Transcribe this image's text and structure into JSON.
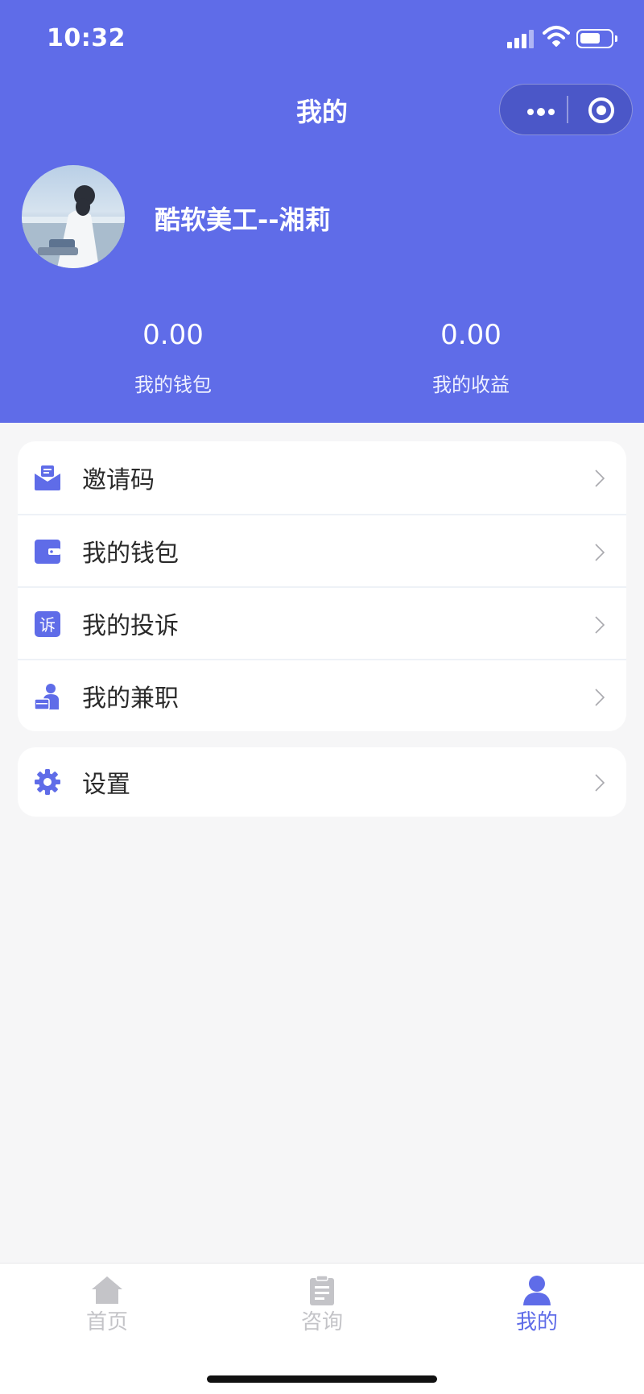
{
  "status": {
    "time": "10:32"
  },
  "nav": {
    "title": "我的"
  },
  "profile": {
    "name": "酷软美工--湘莉"
  },
  "stats": [
    {
      "value": "0.00",
      "label": "我的钱包"
    },
    {
      "value": "0.00",
      "label": "我的收益"
    }
  ],
  "menu": {
    "items": [
      {
        "label": "邀请码",
        "icon": "invite-envelope-icon"
      },
      {
        "label": "我的钱包",
        "icon": "wallet-icon"
      },
      {
        "label": "我的投诉",
        "icon": "complaint-icon",
        "icon_text": "诉"
      },
      {
        "label": "我的兼职",
        "icon": "part-time-job-icon"
      }
    ],
    "settings": {
      "label": "设置",
      "icon": "gear-icon"
    }
  },
  "tabbar": {
    "tabs": [
      {
        "label": "首页",
        "icon": "home-icon",
        "active": false
      },
      {
        "label": "咨询",
        "icon": "clipboard-icon",
        "active": false
      },
      {
        "label": "我的",
        "icon": "user-icon",
        "active": true
      }
    ]
  },
  "colors": {
    "brand": "#5f6ce8",
    "inactive": "#c4c4c8",
    "background": "#f6f6f7"
  }
}
